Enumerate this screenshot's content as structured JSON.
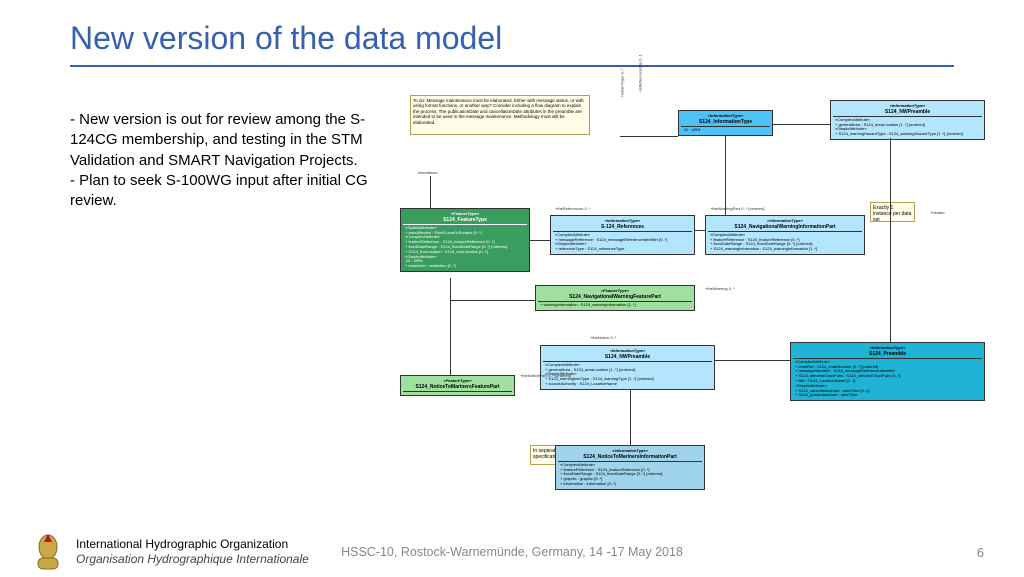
{
  "title": "New version of the data model",
  "body": "- New version is out for review among the S-124CG membership, and testing in the STM Validation and SMART Navigation Projects.\n- Plan to seek S-100WG input after initial CG review.",
  "diagram": {
    "note1": "To do: Message maintenance must be elaborated. Either with message status, or with using format functions, or another way? Consider including a flow diagram to explain the process.\n\nThe publicationDate and cancellationDate attributes in the preamble are intended to be used in the message maintenance. Methodology must still be elaborated.",
    "note2": "Exactly 1 instance per data set",
    "note3": "In separate hypothetical product specification for notice to mariners?",
    "b1": {
      "stereo": "«InformationType»",
      "name": "S124_InformationType",
      "attrs": [
        "-ID : URN"
      ]
    },
    "b2": {
      "stereo": "«InformationType»",
      "name": "S124_NWPreamble",
      "attrs": [
        "«ComplexAttribute»",
        "+ generalArea : S124_areaLocation [1..*] {ordered}",
        "«SimpleAttribute»",
        "+ S124_warningHazardType : S124_warningHazardType [1..*] {ordered}"
      ]
    },
    "b3": {
      "stereo": "«FeatureType»",
      "name": "S124_FeatureType",
      "attrs": [
        "«SpatialAttribute»",
        "+ areaAffected : PointCurveOrSurface [0..*]",
        "«ComplexAttribute»",
        "+ featureReference : S124_featureReference [0..*]",
        "+ fixedDateRange : S124_fixedDateRange [0..*] {ordered}",
        "+ S124_boxLocation : S124_boxLocation [0..1]",
        "«SimpleAttribute»",
        "-ID : URN",
        "+ restriction : restriction [0..*]"
      ]
    },
    "b4": {
      "stereo": "«InformationType»",
      "name": "S-124_References",
      "attrs": [
        "«ComplexAttribute»",
        "+ messageReference : S124_messageReferenceIdentifier [0..*]",
        "«SimpleAttribute»",
        "+ referenceType : S124_referenceType"
      ]
    },
    "b5": {
      "stereo": "«InformationType»",
      "name": "S124_NavigationalWarningInformationPart",
      "attrs": [
        "«ComplexAttribute»",
        "+ featureReference : S124_featureReference [0..*]",
        "+ fixedDateRange : S124_fixedDateRange [0..*] {ordered}",
        "+ S124_warningInformation : S124_warningInformation [1..*]"
      ]
    },
    "b6": {
      "stereo": "«FeatureType»",
      "name": "S124_NavigationalWarningFeaturePart",
      "attrs": [
        "+ warningInformation : S124_warningInformation [1..*]"
      ]
    },
    "b7": {
      "stereo": "«InformationType»",
      "name": "S124_NWPreamble",
      "attrs": [
        "«ComplexAttribute»",
        "+ generalArea : S124_areaLocation [1..*] {ordered}",
        "«SimpleAttribute»",
        "+ S124_warningInfoType : S124_warningType [1..*] {ordered}",
        "+ sourceAuthority : S124_LocationName"
      ]
    },
    "b8": {
      "stereo": "«InformationType»",
      "name": "S124_Preamble",
      "attrs": [
        "«ComplexAttribute»",
        "+ chartRef : S124_chartNumber [0..*] {ordered}",
        "+ messageIdentifier : S124_messageReferenceIdentifier",
        "+ S124_affectedChartPubs : S124_affectedChartPubs [0..*]",
        "+ title : S124_LocationName [0..1]",
        "«SimpleAttribute»",
        "+ S124_cancellationDate : dateTime [0..1]",
        "+ S124_publicationDate : dateTime"
      ]
    },
    "b9": {
      "stereo": "«FeatureType»",
      "name": "S124_NoticeToMarinersFeaturePart"
    },
    "b10": {
      "stereo": "«InformationType»",
      "name": "S124_NoticeToMarinersInformationPart",
      "attrs": [
        "«ComplexAttribute»",
        "+ featureReference : S124_featureReference [0..*]",
        "+ fixedDateRange : S124_fixedDateRange [0..*] {ordered}",
        "+ graphic : graphic [0..*]",
        "+ information : information [0..*]"
      ]
    },
    "labels": {
      "inherit": "inheritance",
      "nwType": "+nwarnType 0..*",
      "refBy": "+isReferencedBy 0..1",
      "theRef": "+theReferences  0..*",
      "theWarnP": "+theWarningPart  0..*  {ordered}",
      "theWarn": "+theWarning  0..*",
      "header": "+header",
      "theNotice": "+theNotice  0..*",
      "theNoticeP": "+theNoticePart  0..*  {ordered}"
    }
  },
  "footer": {
    "org_en": "International Hydrographic Organization",
    "org_fr": "Organisation Hydrographique Internationale",
    "meeting": "HSSC-10, Rostock-Warnemünde, Germany, 14 -17 May 2018",
    "page": "6"
  }
}
